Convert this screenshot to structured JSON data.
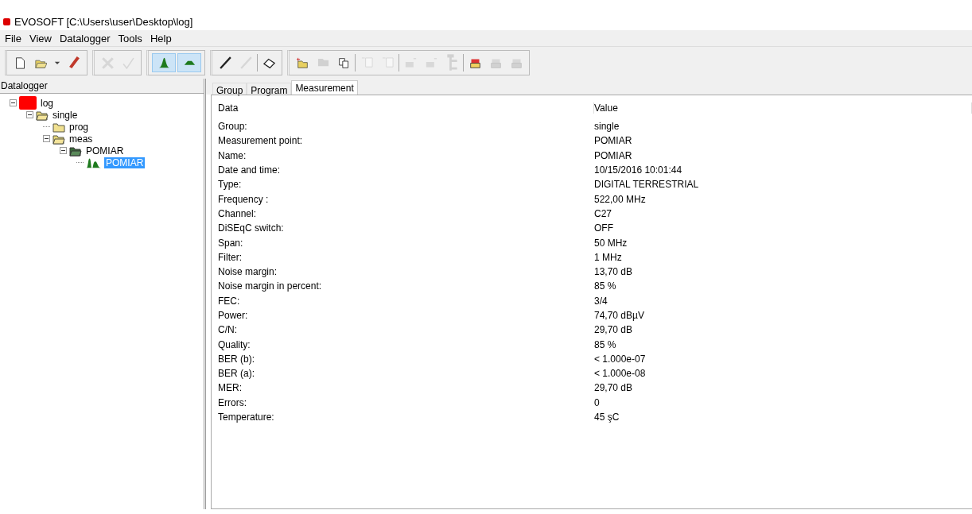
{
  "window": {
    "title": "EVOSOFT [C:\\Users\\user\\Desktop\\log]"
  },
  "menu": [
    "File",
    "View",
    "Datalogger",
    "Tools",
    "Help"
  ],
  "toolbar": [
    [
      [
        {
          "kind": "new",
          "disabled": false,
          "pressed": false
        },
        {
          "kind": "open",
          "disabled": false,
          "pressed": false
        },
        {
          "kind": "dropdown",
          "disabled": false,
          "pressed": false
        },
        {
          "kind": "eraser",
          "disabled": false,
          "pressed": false
        }
      ]
    ],
    [
      [
        {
          "kind": "cancel",
          "disabled": true,
          "pressed": false
        },
        {
          "kind": "accept",
          "disabled": true,
          "pressed": false
        }
      ]
    ],
    [
      [
        {
          "kind": "peak",
          "disabled": false,
          "pressed": true
        },
        {
          "kind": "hill",
          "disabled": false,
          "pressed": true
        }
      ]
    ],
    [
      [
        {
          "kind": "pen",
          "disabled": false,
          "pressed": false
        },
        {
          "kind": "pen",
          "disabled": true,
          "pressed": false
        }
      ],
      [
        {
          "kind": "tag",
          "disabled": false,
          "pressed": false
        }
      ]
    ],
    [
      [
        {
          "kind": "folder-add",
          "disabled": false,
          "pressed": false
        },
        {
          "kind": "folder",
          "disabled": true,
          "pressed": false
        },
        {
          "kind": "copy",
          "disabled": false,
          "pressed": false
        }
      ],
      [
        {
          "kind": "doc-add",
          "disabled": true,
          "pressed": false
        },
        {
          "kind": "doc-remove",
          "disabled": true,
          "pressed": false
        }
      ],
      [
        {
          "kind": "box-add",
          "disabled": true,
          "pressed": false
        },
        {
          "kind": "box-remove",
          "disabled": true,
          "pressed": false
        },
        {
          "kind": "tree",
          "disabled": true,
          "pressed": false
        }
      ],
      [
        {
          "kind": "export",
          "disabled": false,
          "pressed": false
        },
        {
          "kind": "import",
          "disabled": true,
          "pressed": false
        },
        {
          "kind": "stack",
          "disabled": true,
          "pressed": false
        }
      ]
    ]
  ],
  "sidebar": {
    "header": "Datalogger",
    "tree": [
      {
        "label": "log",
        "kind": "logger",
        "expanded": true,
        "selected": false,
        "children": [
          {
            "label": "single",
            "kind": "folder",
            "expanded": true,
            "selected": false,
            "children": [
              {
                "label": "prog",
                "kind": "closed-folder",
                "selected": false
              },
              {
                "label": "meas",
                "kind": "folder",
                "expanded": true,
                "selected": false,
                "children": [
                  {
                    "label": "POMIAR",
                    "kind": "green-folder",
                    "expanded": true,
                    "selected": false,
                    "children": [
                      {
                        "label": "POMIAR",
                        "kind": "measurement",
                        "selected": true
                      }
                    ]
                  }
                ]
              }
            ]
          }
        ]
      }
    ]
  },
  "tabs": [
    {
      "label": "Group",
      "selected": false
    },
    {
      "label": "Program",
      "selected": false
    },
    {
      "label": "Measurement",
      "selected": true
    }
  ],
  "table": {
    "columns": [
      "Data",
      "Value"
    ],
    "rows": [
      [
        "Group:",
        "single"
      ],
      [
        "Measurement point:",
        "POMIAR"
      ],
      [
        "Name:",
        "POMIAR"
      ],
      [
        "Date and time:",
        "10/15/2016 10:01:44"
      ],
      [
        "Type:",
        "DIGITAL TERRESTRIAL"
      ],
      [
        "Frequency :",
        "522,00 MHz"
      ],
      [
        "Channel:",
        "C27"
      ],
      [
        "DiSEqC switch:",
        "OFF"
      ],
      [
        "Span:",
        "50 MHz"
      ],
      [
        "Filter:",
        "1 MHz"
      ],
      [
        "Noise margin:",
        "13,70 dB"
      ],
      [
        "Noise margin in percent:",
        "85 %"
      ],
      [
        "FEC:",
        "3/4"
      ],
      [
        "Power:",
        "74,70 dBµV"
      ],
      [
        "C/N:",
        "29,70 dB"
      ],
      [
        "Quality:",
        "85 %"
      ],
      [
        "BER (b):",
        "< 1.000e-07"
      ],
      [
        "BER (a):",
        "< 1.000e-08"
      ],
      [
        "MER:",
        "29,70 dB"
      ],
      [
        "Errors:",
        "0"
      ],
      [
        "Temperature:",
        "45 şC"
      ]
    ]
  }
}
